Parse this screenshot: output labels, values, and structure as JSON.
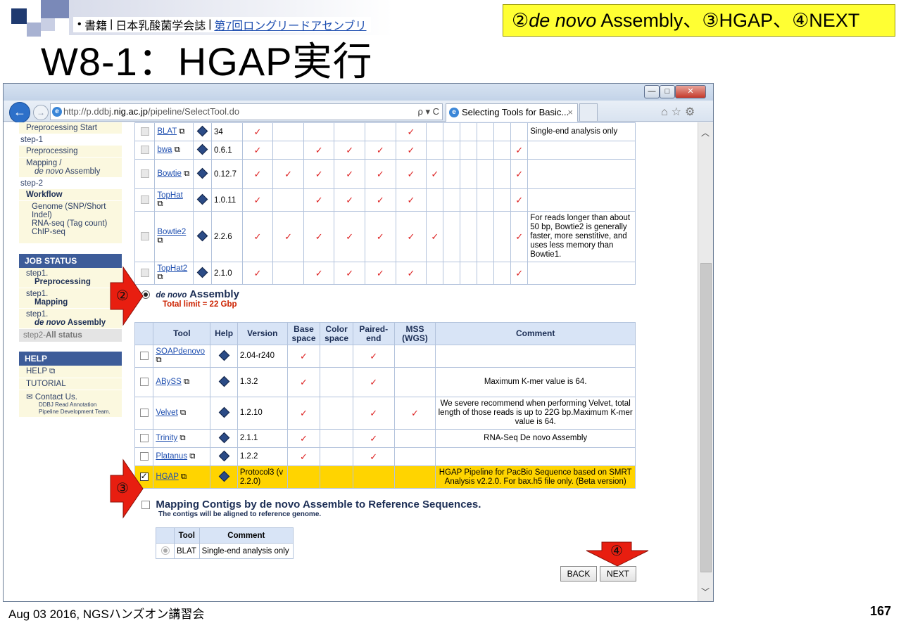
{
  "slide": {
    "title": "W8-1：HGAP実行",
    "source_bullet": "•",
    "source_book": "書籍",
    "source_journal": "日本乳酸菌学会誌",
    "source_link": "第7回ロングリードアセンブリ",
    "callout_num1": "②",
    "callout_italic": "de novo",
    "callout_rest": " Assembly、③HGAP、④NEXT",
    "footer_left": "Aug 03 2016, NGSハンズオン講習会",
    "page_number": "167"
  },
  "browser": {
    "url_pre": "http://p.ddbj.",
    "url_host": "nig.ac.jp",
    "url_post": "/pipeline/SelectTool.do",
    "url_tools": "ρ ▾ C",
    "tab_title": "Selecting Tools for Basic...",
    "tab_close": "×",
    "win_min": "—",
    "win_max": "□",
    "win_close": "✕",
    "toolbar_icons": "⌂☆⚙"
  },
  "sidebar": {
    "preprocessing_start": "Preprocessing Start",
    "step1": "step-1",
    "preprocessing": "Preprocessing",
    "mapping": "Mapping /",
    "denovo_italic": "de novo",
    "assembly": " Assembly",
    "step2": "step-2",
    "workflow": "Workflow",
    "genome": "Genome (SNP/Short Indel)",
    "rnaseq": "RNA-seq (Tag count)",
    "chipseq": "ChIP-seq",
    "job_status": "JOB STATUS",
    "js1_step": "step1.",
    "js1_name": "Preprocessing",
    "js2_step": "step1.",
    "js2_name": "Mapping",
    "js3_step": "step1.",
    "js3_italic": "de novo",
    "js3_name": " Assembly",
    "js_all_pre": "step2-",
    "js_all_bold": "All status",
    "help_head": "HELP",
    "help_link": "HELP",
    "tutorial": "TUTORIAL",
    "contact": "Contact Us.",
    "team": "DDBJ Read Annotation Pipeline Development Team."
  },
  "mapping_tools": [
    {
      "name": "BLAT",
      "version": "34",
      "ticks": [
        1,
        0,
        0,
        0,
        0,
        1,
        0,
        0,
        0,
        0,
        0,
        0
      ],
      "comment": "Single-end analysis only"
    },
    {
      "name": "bwa",
      "version": "0.6.1",
      "ticks": [
        1,
        0,
        1,
        1,
        1,
        1,
        0,
        0,
        0,
        0,
        0,
        1
      ],
      "comment": ""
    },
    {
      "name": "Bowtie",
      "version": "0.12.7",
      "ticks": [
        1,
        1,
        1,
        1,
        1,
        1,
        1,
        0,
        0,
        0,
        0,
        1
      ],
      "comment": ""
    },
    {
      "name": "TopHat",
      "version": "1.0.11",
      "ticks": [
        1,
        0,
        1,
        1,
        1,
        1,
        0,
        0,
        0,
        0,
        0,
        1
      ],
      "comment": ""
    },
    {
      "name": "Bowtie2",
      "version": "2.2.6",
      "ticks": [
        1,
        1,
        1,
        1,
        1,
        1,
        1,
        0,
        0,
        0,
        0,
        1
      ],
      "comment": "For reads longer than about 50 bp, Bowtie2 is generally faster, more senstitive, and uses less memory than Bowtie1."
    },
    {
      "name": "TopHat2",
      "version": "2.1.0",
      "ticks": [
        1,
        0,
        1,
        1,
        1,
        1,
        0,
        0,
        0,
        0,
        0,
        1
      ],
      "comment": ""
    }
  ],
  "denovo": {
    "italic": "de novo",
    "title": "Assembly",
    "limit": "Total limit = 22 Gbp",
    "headers": [
      "Tool",
      "Help",
      "Version",
      "Base space",
      "Color space",
      "Paired-end",
      "MSS (WGS)",
      "Comment"
    ],
    "rows": [
      {
        "name": "SOAPdenovo",
        "version": "2.04-r240",
        "base": true,
        "color": false,
        "paired": true,
        "mss": false,
        "comment": "",
        "checked": false
      },
      {
        "name": "ABySS",
        "version": "1.3.2",
        "base": true,
        "color": false,
        "paired": true,
        "mss": false,
        "comment": "Maximum K-mer value is 64.",
        "checked": false
      },
      {
        "name": "Velvet",
        "version": "1.2.10",
        "base": true,
        "color": false,
        "paired": true,
        "mss": true,
        "comment": "We severe recommend when performing Velvet, total length of those reads is up to 22G bp.Maximum K-mer value is 64.",
        "checked": false
      },
      {
        "name": "Trinity",
        "version": "2.1.1",
        "base": true,
        "color": false,
        "paired": true,
        "mss": false,
        "comment": "RNA-Seq De novo Assembly",
        "checked": false
      },
      {
        "name": "Platanus",
        "version": "1.2.2",
        "base": true,
        "color": false,
        "paired": true,
        "mss": false,
        "comment": "",
        "checked": false
      },
      {
        "name": "HGAP",
        "version": "Protocol3 (v 2.2.0)",
        "base": false,
        "color": false,
        "paired": false,
        "mss": false,
        "comment": "HGAP Pipeline for PacBio Sequence based on SMRT Analysis v2.2.0. For bax.h5 file only. (Beta version)",
        "checked": true
      }
    ]
  },
  "mapping_contigs": {
    "title": "Mapping Contigs by de novo Assemble to Reference Sequences.",
    "subtitle": "The contigs will be aligned to reference genome.",
    "headers": [
      "Tool",
      "Comment"
    ],
    "row_tool": "BLAT",
    "row_comment": "Single-end analysis only"
  },
  "buttons": {
    "back": "BACK",
    "next": "NEXT"
  },
  "annotations": {
    "a2": "②",
    "a3": "③",
    "a4": "④",
    "arrow_color": "#e81e10"
  }
}
